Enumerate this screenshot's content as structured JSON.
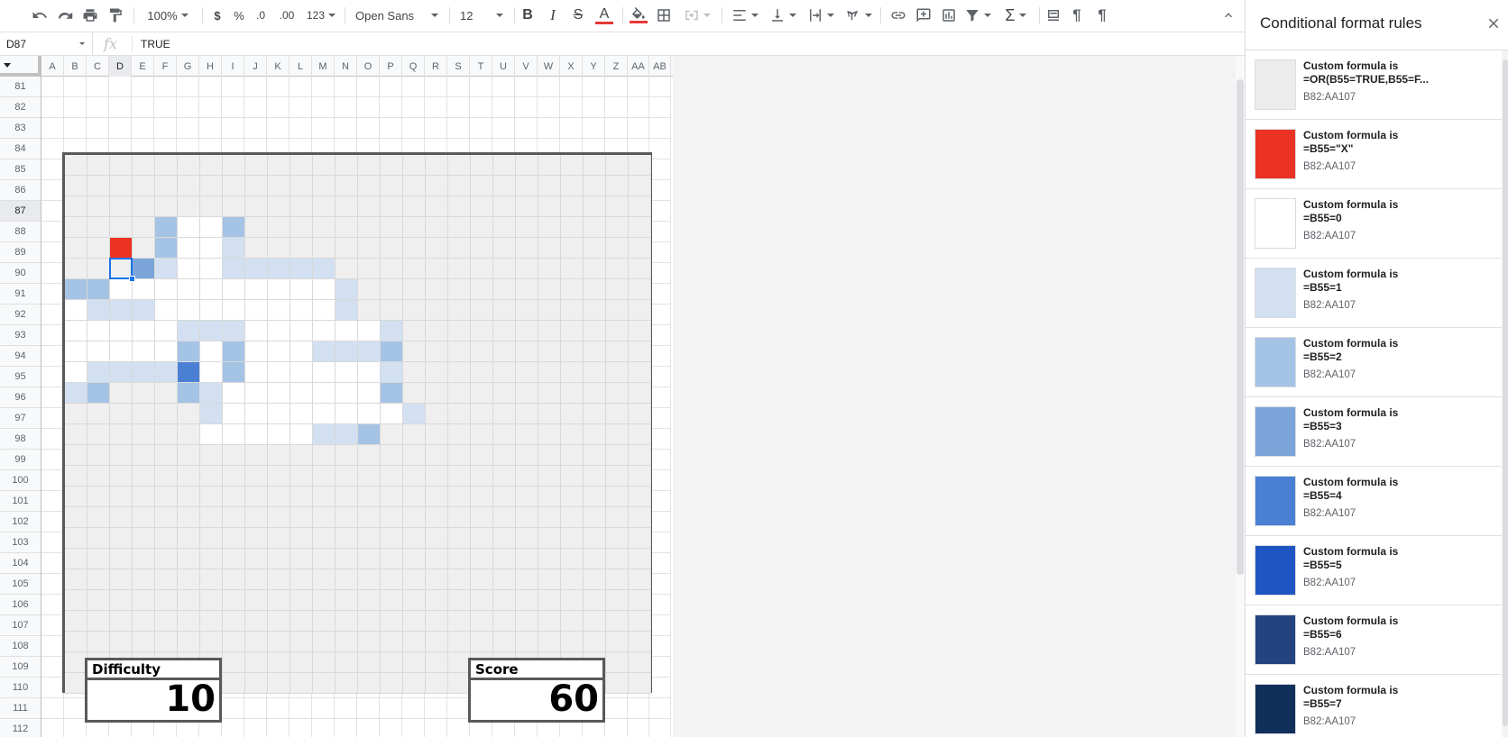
{
  "toolbar": {
    "zoom": "100%",
    "currency_label": "$",
    "percent_label": "%",
    "decrease_decimal_label": ".0",
    "increase_decimal_label": ".00",
    "more_formats_label": "123",
    "font": "Open Sans",
    "font_size": "12"
  },
  "formula_bar": {
    "cell_ref": "D87",
    "fx_label": "fx",
    "value": "TRUE"
  },
  "sheet": {
    "columns": [
      "A",
      "B",
      "C",
      "D",
      "E",
      "F",
      "G",
      "H",
      "I",
      "J",
      "K",
      "L",
      "M",
      "N",
      "O",
      "P",
      "Q",
      "R",
      "S",
      "T",
      "U",
      "V",
      "W",
      "X",
      "Y",
      "Z",
      "AA",
      "AB"
    ],
    "selected_column": "D",
    "rows": [
      "81",
      "82",
      "83",
      "84",
      "85",
      "86",
      "87",
      "88",
      "89",
      "90",
      "91",
      "92",
      "93",
      "94",
      "95",
      "96",
      "97",
      "98",
      "99",
      "100",
      "101",
      "102",
      "103",
      "104",
      "105",
      "106",
      "107",
      "108",
      "109",
      "110",
      "111",
      "112"
    ],
    "selected_row": "87",
    "board": {
      "range": "B82:AA107",
      "colors": {
        "hidden": "#efefef",
        "bomb": "#ea3323",
        "zero": "#ffffff",
        "one": "#d2e0f2",
        "two": "#a5c3e5",
        "three": "#7ba5d8",
        "four": "#4a7fd4",
        "five": "#1e55c3",
        "six": "#22437e",
        "seven": "#10305a"
      },
      "rows": [
        "..........................",
        "..........................",
        "..........................",
        "....2002..................",
        "..X.2001..................",
        "...310011111..............",
        "2200000000001.............",
        "0111000000001.............",
        "000001110000001...........",
        "000002020001112...........",
        "011114020000001...........",
        "12...2100000002...........",
        "......1000000001..........",
        "......00000112............",
        "..........................",
        "..........................",
        "..........................",
        "..........................",
        "..........................",
        "..........................",
        "..........................",
        "..........................",
        "..........................",
        "..........................",
        "..........................",
        ".........................."
      ]
    },
    "difficulty": {
      "label": "Difficulty",
      "value": "10"
    },
    "score": {
      "label": "Score",
      "value": "60"
    }
  },
  "panel": {
    "title": "Conditional format rules",
    "rules": [
      {
        "line1": "Custom formula is",
        "line2": "=OR(B55=TRUE,B55=F...",
        "range": "B82:AA107",
        "color": "#ececec"
      },
      {
        "line1": "Custom formula is",
        "line2": "=B55=\"X\"",
        "range": "B82:AA107",
        "color": "#ea3323"
      },
      {
        "line1": "Custom formula is",
        "line2": "=B55=0",
        "range": "B82:AA107",
        "color": "#ffffff"
      },
      {
        "line1": "Custom formula is",
        "line2": "=B55=1",
        "range": "B82:AA107",
        "color": "#d2e0f2"
      },
      {
        "line1": "Custom formula is",
        "line2": "=B55=2",
        "range": "B82:AA107",
        "color": "#a5c3e5"
      },
      {
        "line1": "Custom formula is",
        "line2": "=B55=3",
        "range": "B82:AA107",
        "color": "#7ba5d8"
      },
      {
        "line1": "Custom formula is",
        "line2": "=B55=4",
        "range": "B82:AA107",
        "color": "#4a7fd4"
      },
      {
        "line1": "Custom formula is",
        "line2": "=B55=5",
        "range": "B82:AA107",
        "color": "#1e55c3"
      },
      {
        "line1": "Custom formula is",
        "line2": "=B55=6",
        "range": "B82:AA107",
        "color": "#22437e"
      },
      {
        "line1": "Custom formula is",
        "line2": "=B55=7",
        "range": "B82:AA107",
        "color": "#10305a"
      }
    ]
  }
}
